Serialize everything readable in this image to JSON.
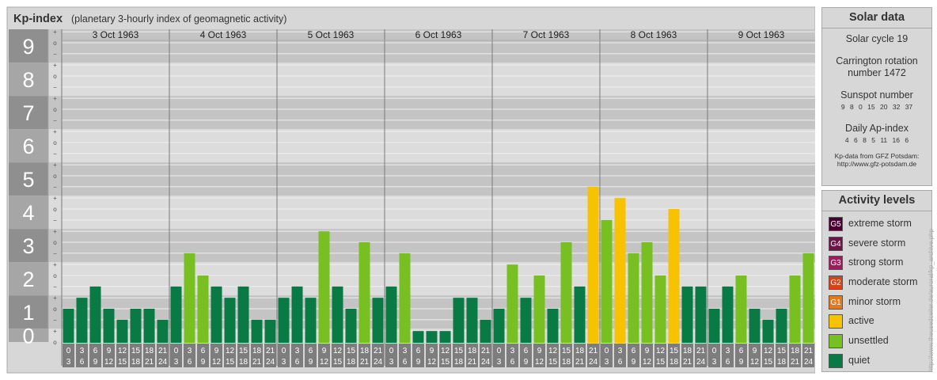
{
  "header": {
    "title": "Kp-index",
    "subtitle": "(planetary 3-hourly index of geomagnetic activity)"
  },
  "chart_data": {
    "type": "bar",
    "title": "Kp-index",
    "subtitle": "(planetary 3-hourly index of geomagnetic activity)",
    "ylim": [
      0,
      9
    ],
    "y_ticks": [
      "0",
      "1",
      "2",
      "3",
      "4",
      "5",
      "6",
      "7",
      "8",
      "9"
    ],
    "y_minor_labels": [
      "+",
      "o",
      "−"
    ],
    "days": [
      "3 Oct 1963",
      "4 Oct 1963",
      "5 Oct 1963",
      "6 Oct 1963",
      "7 Oct 1963",
      "8 Oct 1963",
      "9 Oct 1963"
    ],
    "hour_ticks": [
      [
        "0",
        "3"
      ],
      [
        "3",
        "6"
      ],
      [
        "6",
        "9"
      ],
      [
        "9",
        "12"
      ],
      [
        "12",
        "15"
      ],
      [
        "15",
        "18"
      ],
      [
        "18",
        "21"
      ],
      [
        "21",
        "24"
      ]
    ],
    "values": [
      [
        1.0,
        1.33,
        1.67,
        1.0,
        0.67,
        1.0,
        1.0,
        0.67
      ],
      [
        1.67,
        2.67,
        2.0,
        1.67,
        1.33,
        1.67,
        0.67,
        0.67
      ],
      [
        1.33,
        1.67,
        1.33,
        3.33,
        1.67,
        1.0,
        3.0,
        1.33
      ],
      [
        1.67,
        2.67,
        0.33,
        0.33,
        0.33,
        1.33,
        1.33,
        0.67
      ],
      [
        1.0,
        2.33,
        1.33,
        2.0,
        1.0,
        3.0,
        1.67,
        4.67
      ],
      [
        3.67,
        4.33,
        2.67,
        3.0,
        2.0,
        4.0,
        1.67,
        1.67
      ],
      [
        1.0,
        1.67,
        2.0,
        1.0,
        0.67,
        1.0,
        2.0,
        2.67
      ]
    ],
    "levels": {
      "quiet": {
        "max": 1.67,
        "color": "#0a7a45"
      },
      "unsettled": {
        "max": 3.67,
        "color": "#78bf22"
      },
      "active": {
        "max": 4.67,
        "color": "#f7c200"
      },
      "minor_storm": {
        "max": 5.67,
        "color": "#e57917"
      }
    },
    "colors": {
      "quiet": "#0a7a45",
      "unsettled": "#78bf22",
      "active": "#f7c200",
      "g1": "#e57917",
      "g2": "#d4451a",
      "g3": "#a31a5c",
      "g4": "#6e1447",
      "g5": "#4a0030",
      "band_dark": "#c4c4c4",
      "band_light": "#dcdcdc",
      "axis_dark": "#8f8f8f",
      "axis_light": "#a6a6a6"
    }
  },
  "solar": {
    "title": "Solar data",
    "cycle": "Solar cycle 19",
    "carrington_1": "Carrington rotation",
    "carrington_2": "number 1472",
    "sunspot_title": "Sunspot number",
    "sunspot_values": [
      "9",
      "8",
      "0",
      "15",
      "20",
      "32",
      "37"
    ],
    "ap_title": "Daily Ap-index",
    "ap_values": [
      "4",
      "6",
      "8",
      "5",
      "11",
      "16",
      "6"
    ],
    "source_1": "Kp-data from GFZ Potsdam:",
    "source_2": "http://www.gfz-potsdam.de"
  },
  "activity": {
    "title": "Activity levels",
    "items": [
      {
        "code": "G5",
        "label": "extreme storm",
        "color": "#4a0030"
      },
      {
        "code": "G4",
        "label": "severe storm",
        "color": "#6e1447"
      },
      {
        "code": "G3",
        "label": "strong storm",
        "color": "#a31a5c"
      },
      {
        "code": "G2",
        "label": "moderate storm",
        "color": "#d4451a"
      },
      {
        "code": "G1",
        "label": "minor storm",
        "color": "#e57917"
      },
      {
        "code": "",
        "label": "active",
        "color": "#f7c200"
      },
      {
        "code": "",
        "label": "unsettled",
        "color": "#78bf22"
      },
      {
        "code": "",
        "label": "quiet",
        "color": "#0a7a45"
      }
    ]
  },
  "watermark": "http://www.theusedceiler.de/auroral/kp_archive.php"
}
